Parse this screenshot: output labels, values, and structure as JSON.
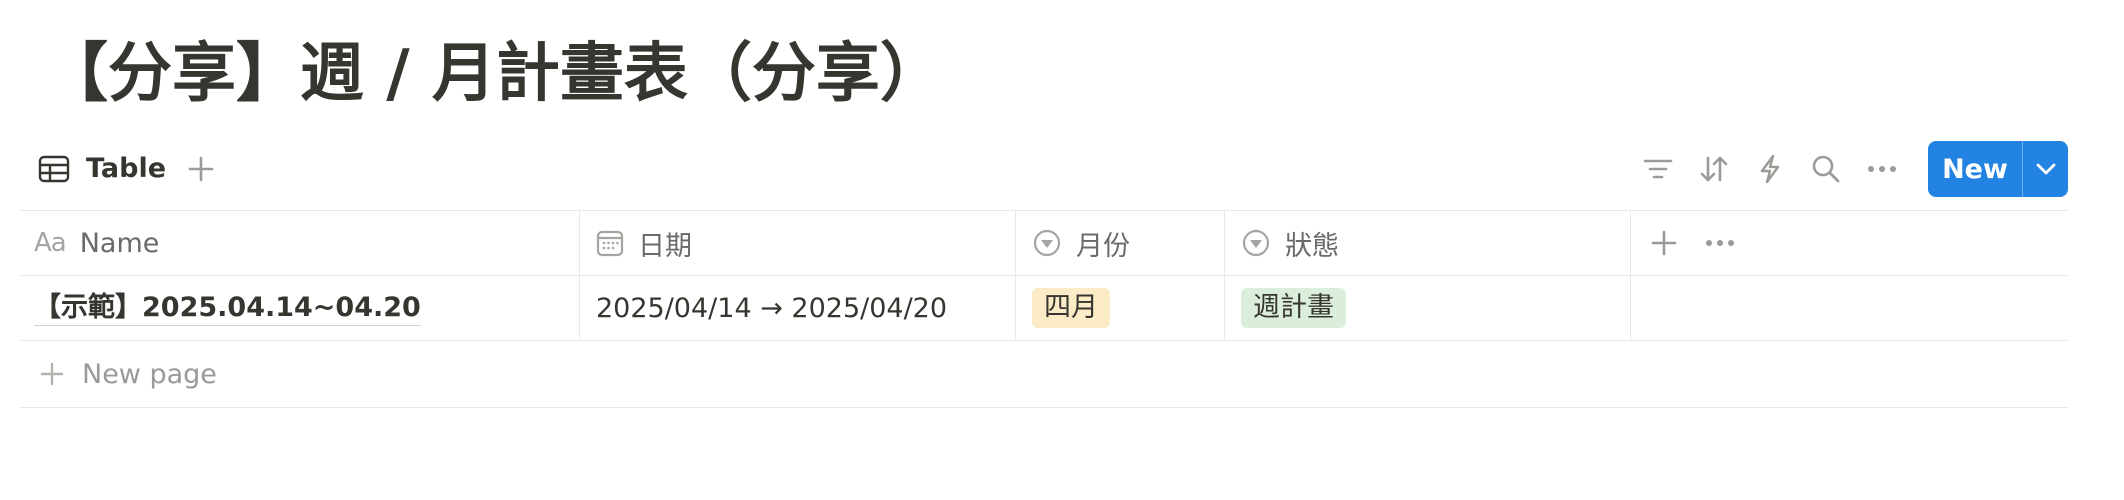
{
  "page": {
    "title": "【分享】週 / 月計畫表（分享）"
  },
  "view": {
    "tab_label": "Table",
    "tab_icon": "table-icon",
    "add_view_icon": "plus-icon"
  },
  "toolbar": {
    "icons": [
      "filter-icon",
      "sort-icon",
      "automation-icon",
      "search-icon",
      "more-icon"
    ],
    "new_label": "New",
    "new_color": "#2383e2"
  },
  "table": {
    "columns": [
      {
        "label": "Name",
        "icon": "aa-text-icon",
        "icon_text": "Aa"
      },
      {
        "label": "日期",
        "icon": "calendar-icon"
      },
      {
        "label": "月份",
        "icon": "select-icon"
      },
      {
        "label": "狀態",
        "icon": "select-icon"
      }
    ],
    "rows": [
      {
        "name": "【示範】2025.04.14~04.20",
        "date": "2025/04/14 → 2025/04/20",
        "month": {
          "label": "四月",
          "color": "#fbecc7"
        },
        "status": {
          "label": "週計畫",
          "color": "#dbeddb"
        }
      }
    ],
    "new_page_label": "New page"
  }
}
